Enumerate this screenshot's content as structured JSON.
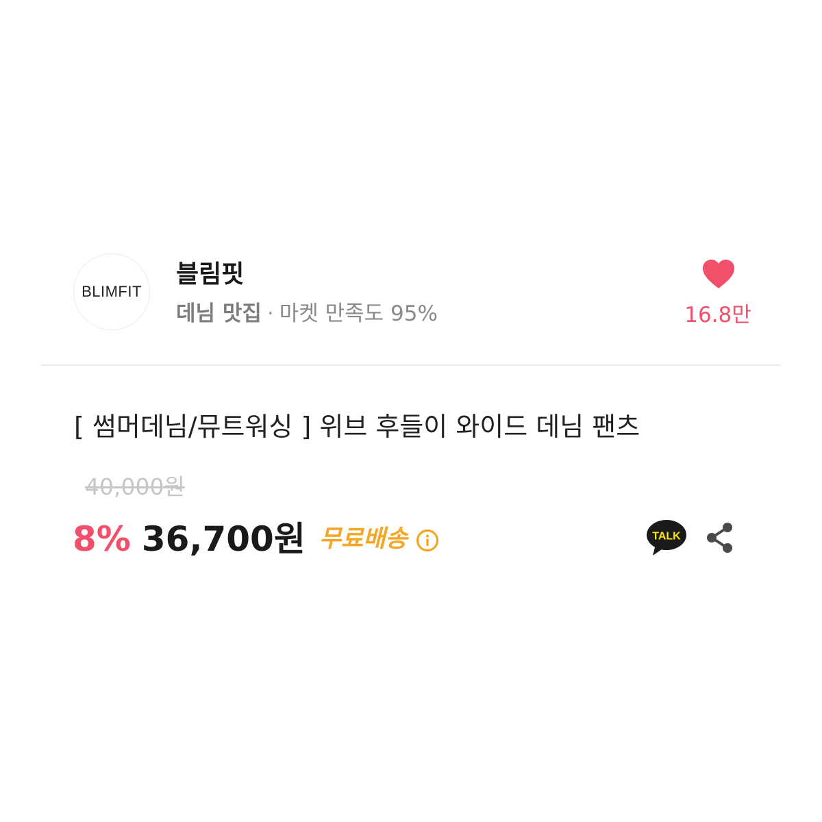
{
  "store": {
    "logo_text": "BLIMFIT",
    "name": "블림핏",
    "tag": "데님 맛집",
    "separator": "·",
    "satisfaction": "마켓 만족도 95%"
  },
  "like": {
    "icon": "heart-icon",
    "count": "16.8만"
  },
  "product": {
    "title": "[ 썸머데님/뮤트워싱 ] 위브 후들이 와이드 데님 팬츠",
    "original_price": "40,000원",
    "discount_rate": "8%",
    "sale_price": "36,700원",
    "shipping_badge": "무료배송",
    "shipping_info_icon": "info-icon"
  },
  "actions": {
    "talk_label": "TALK",
    "talk_icon": "kakao-talk-icon",
    "share_icon": "share-icon"
  },
  "colors": {
    "accent_pink": "#f2506a",
    "shipping_orange": "#f5a623",
    "kakao_bubble": "#1a1a1a",
    "kakao_text": "#fee500"
  }
}
